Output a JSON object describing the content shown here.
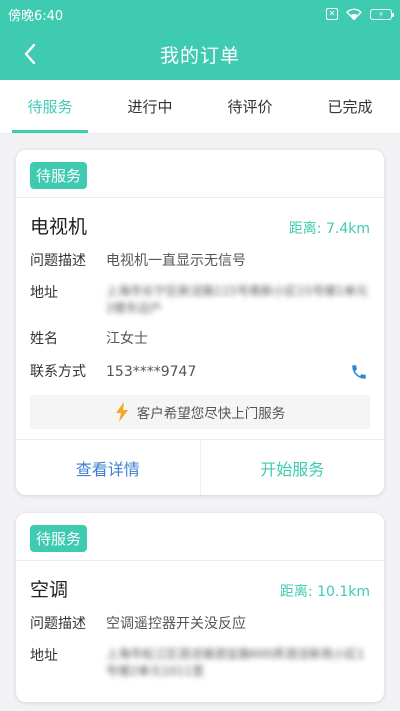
{
  "status_bar": {
    "time": "傍晚6:40",
    "battery_label": "⚡"
  },
  "header": {
    "title": "我的订单"
  },
  "tabs": [
    {
      "label": "待服务",
      "active": true
    },
    {
      "label": "进行中",
      "active": false
    },
    {
      "label": "待评价",
      "active": false
    },
    {
      "label": "已完成",
      "active": false
    }
  ],
  "colors": {
    "accent": "#3fcab2",
    "link_blue": "#3d7fd1",
    "hint_bolt": "#f5a623"
  },
  "labels": {
    "issue": "问题描述",
    "address": "地址",
    "name": "姓名",
    "contact": "联系方式"
  },
  "orders": [
    {
      "status": "待服务",
      "device": "电视机",
      "distance": "距离: 7.4km",
      "issue": "电视机一直显示无信号",
      "address_blurred": "上海市长宁区新泾路115号南新小区15号楼1单元2楼东边户",
      "name": "江女士",
      "phone": "153****9747",
      "hint": "客户希望您尽快上门服务",
      "detail_btn": "查看详情",
      "start_btn": "开始服务"
    },
    {
      "status": "待服务",
      "device": "空调",
      "distance": "距离: 10.1km",
      "issue": "空调遥控器开关没反应",
      "address_blurred": "上海市松江区泗泾镇泗宝路600弄泗泾新苑小区1号楼2单元1011室"
    }
  ]
}
